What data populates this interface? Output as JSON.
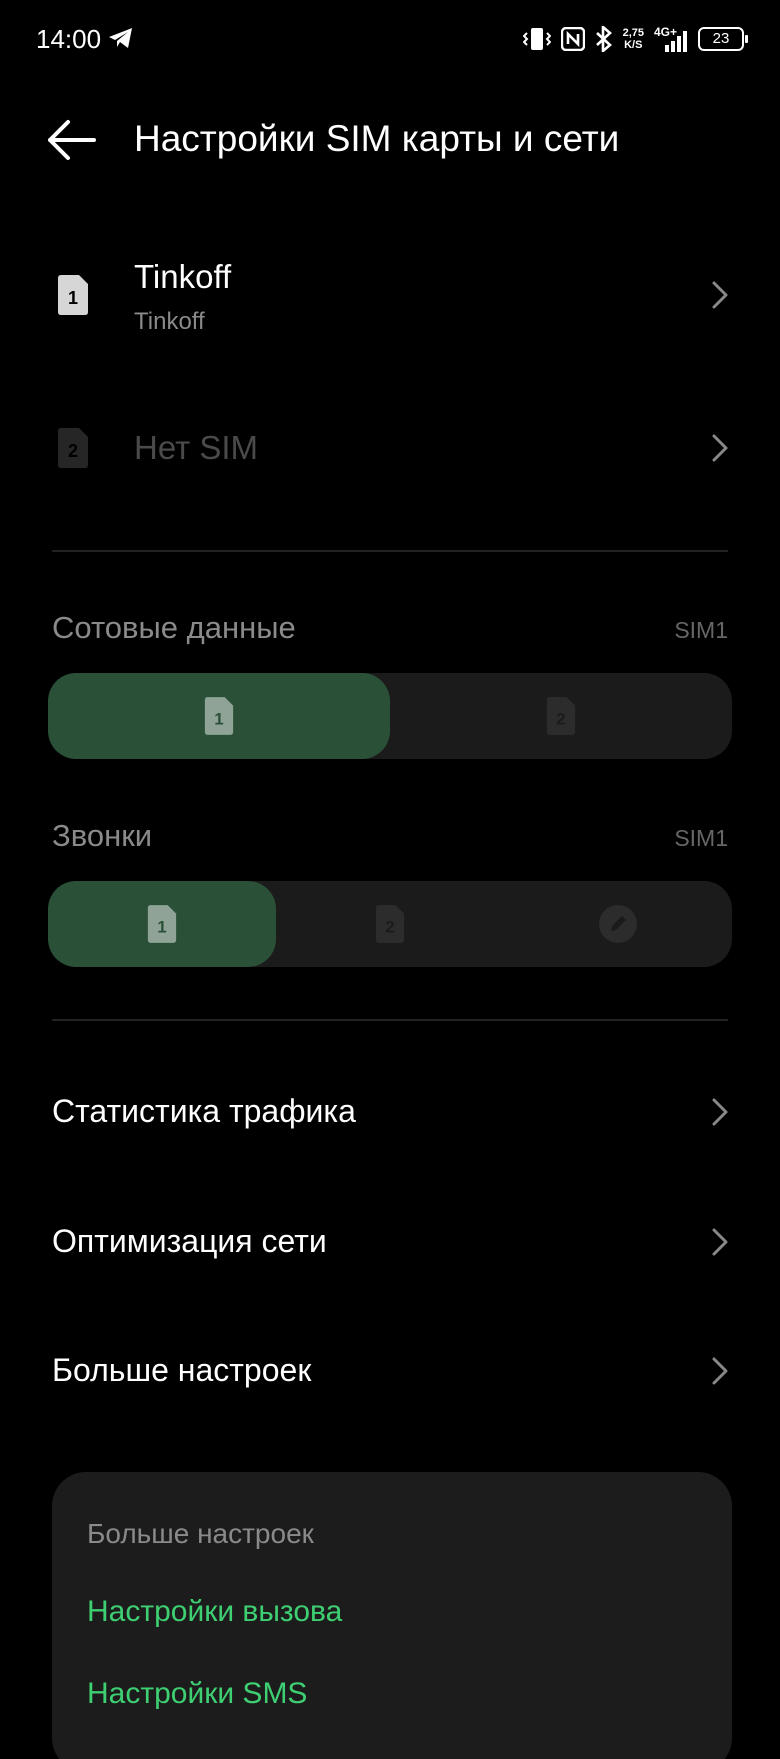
{
  "status_bar": {
    "time": "14:00",
    "network_speed_value": "2,75",
    "network_speed_unit": "K/S",
    "network_type": "4G+",
    "battery": "23"
  },
  "header": {
    "title": "Настройки SIM карты и сети"
  },
  "sims": [
    {
      "slot": "1",
      "name": "Tinkoff",
      "carrier": "Tinkoff",
      "active": true
    },
    {
      "slot": "2",
      "name": "Нет SIM",
      "carrier": "",
      "active": false
    }
  ],
  "cellular_data": {
    "label": "Сотовые данные",
    "value": "SIM1",
    "options": [
      "1",
      "2"
    ],
    "selected": "1"
  },
  "calls": {
    "label": "Звонки",
    "value": "SIM1",
    "options": [
      "1",
      "2",
      "ask"
    ],
    "selected": "1"
  },
  "menu": [
    {
      "label": "Статистика трафика"
    },
    {
      "label": "Оптимизация сети"
    },
    {
      "label": "Больше настроек"
    }
  ],
  "sheet": {
    "title": "Больше настроек",
    "links": [
      "Настройки вызова",
      "Настройки SMS"
    ]
  },
  "colors": {
    "accent": "#3ecf72",
    "active_segment": "#2a5138",
    "background": "#000000"
  }
}
